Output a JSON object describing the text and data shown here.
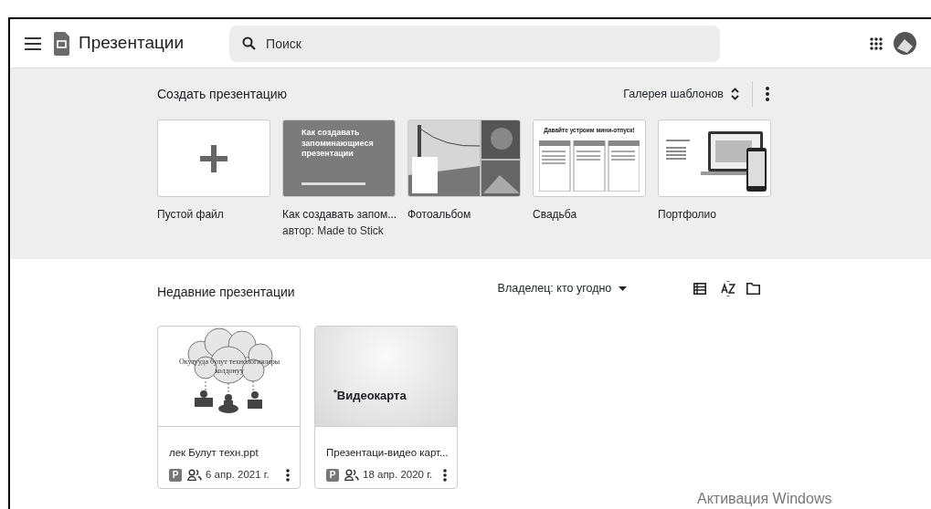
{
  "header": {
    "app_title": "Презентации",
    "search": {
      "placeholder": "Поиск"
    }
  },
  "templates": {
    "title": "Создать презентацию",
    "gallery_label": "Галерея шаблонов",
    "items": [
      {
        "kind": "blank",
        "label": "Пустой файл"
      },
      {
        "kind": "text-slide",
        "label": "Как создавать запом...",
        "author": "автор: Made to Stick",
        "slide_title": "Как создавать запоминающиеся презентации"
      },
      {
        "kind": "photo-album",
        "label": "Фотоальбом"
      },
      {
        "kind": "table-slide",
        "label": "Свадьба",
        "slide_title": "Давайте устроим мини-отпуск!"
      },
      {
        "kind": "devices",
        "label": "Портфолио"
      }
    ]
  },
  "recent": {
    "title": "Недавние презентации",
    "owner_filter": "Владелец: кто угодно",
    "files": [
      {
        "kind": "cloud",
        "name": "лек Булут техн.ppt",
        "badge": "P",
        "shared": true,
        "date": "6 апр. 2021 г.",
        "slide_text": "Окутууда булут технологиялары колдонуу"
      },
      {
        "kind": "title",
        "name": "Презентаци-видео карт...",
        "badge": "P",
        "shared": true,
        "date": "18 апр. 2020 г.",
        "slide_text": "$^{*}$Видеокарта"
      }
    ]
  },
  "os_notice": "Активация Windows"
}
